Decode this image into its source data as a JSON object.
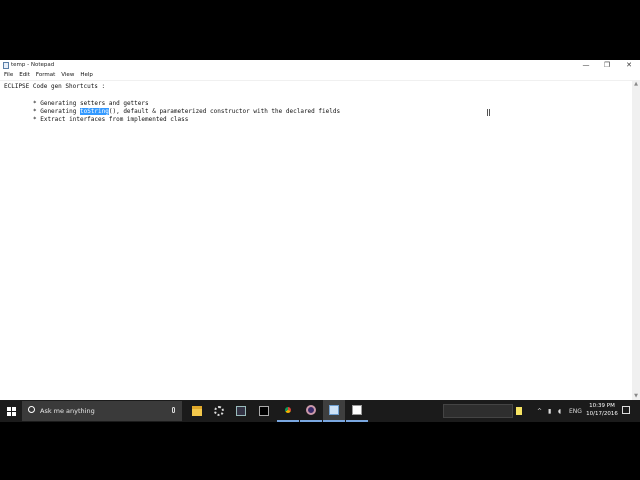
{
  "window": {
    "title": "temp - Notepad",
    "controls": {
      "minimize": "—",
      "maximize": "❐",
      "close": "✕"
    }
  },
  "menu": [
    "File",
    "Edit",
    "Format",
    "View",
    "Help"
  ],
  "document": {
    "line1": "ECLIPSE Code gen Shortcuts :",
    "line2_pre": "* Generating ",
    "line2_link": "setters",
    "line2_post": " and getters",
    "line3_pre": "* Generating ",
    "line3_sel": "toString",
    "line3_post": "(), default & parameterized constructor with the declared fields",
    "line4": "* Extract interfaces from implemented class"
  },
  "taskbar": {
    "search_placeholder": "Ask me anything",
    "tray_lang": "ENG",
    "time": "10:39 PM",
    "date": "10/17/2016"
  },
  "colors": {
    "selection": "#3399ff",
    "taskbar": "#1b1b1b",
    "accent": "#7aa7e0"
  }
}
